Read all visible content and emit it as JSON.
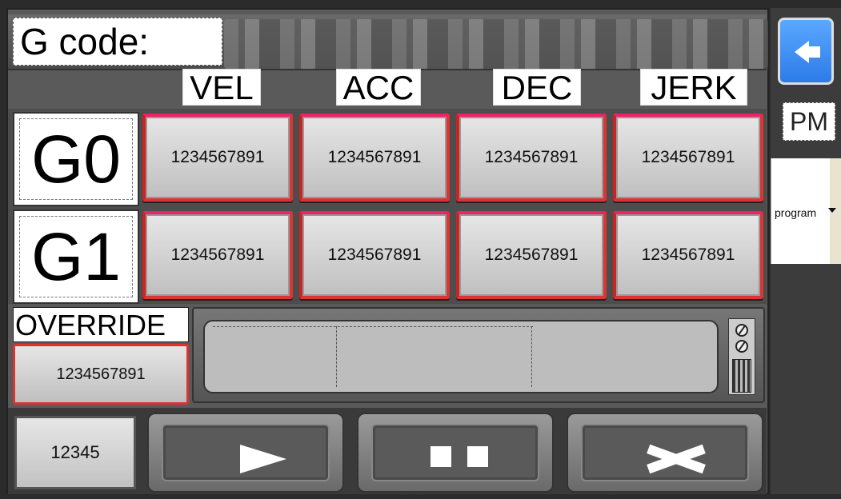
{
  "header": {
    "gcode_label": "G code:"
  },
  "columns": [
    "VEL",
    "ACC",
    "DEC",
    "JERK"
  ],
  "rows": [
    {
      "label": "G0",
      "values": [
        "1234567891",
        "1234567891",
        "1234567891",
        "1234567891"
      ]
    },
    {
      "label": "G1",
      "values": [
        "1234567891",
        "1234567891",
        "1234567891",
        "1234567891"
      ]
    }
  ],
  "override": {
    "label": "OVERRIDE",
    "value": "1234567891"
  },
  "bottom": {
    "counter_value": "12345",
    "controls": [
      "play-icon",
      "pause-icon",
      "close-icon"
    ]
  },
  "side": {
    "back_icon": "back-arrow-icon",
    "mode_label": "PM",
    "program_select_value": "program"
  },
  "colors": {
    "accent_red": "#dd3333",
    "back_button_blue": "#2d7be8"
  }
}
